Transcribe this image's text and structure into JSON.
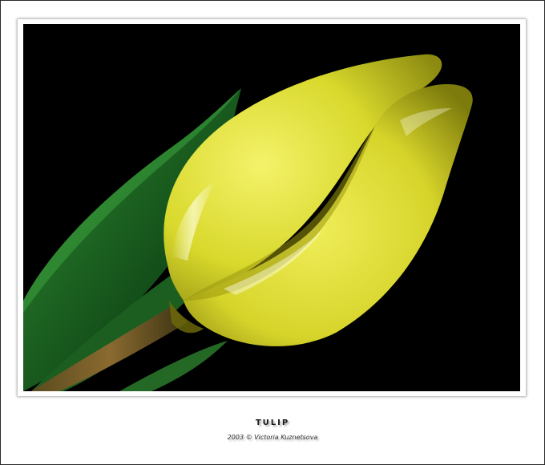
{
  "caption": {
    "title": "TULIP",
    "credit": "2003 © Victoria Kuznetsova"
  },
  "photo": {
    "subject": "yellow-tulip-bud",
    "background_color": "#000000",
    "petal_color": "#e2e23a",
    "leaf_color": "#1f6a22"
  }
}
